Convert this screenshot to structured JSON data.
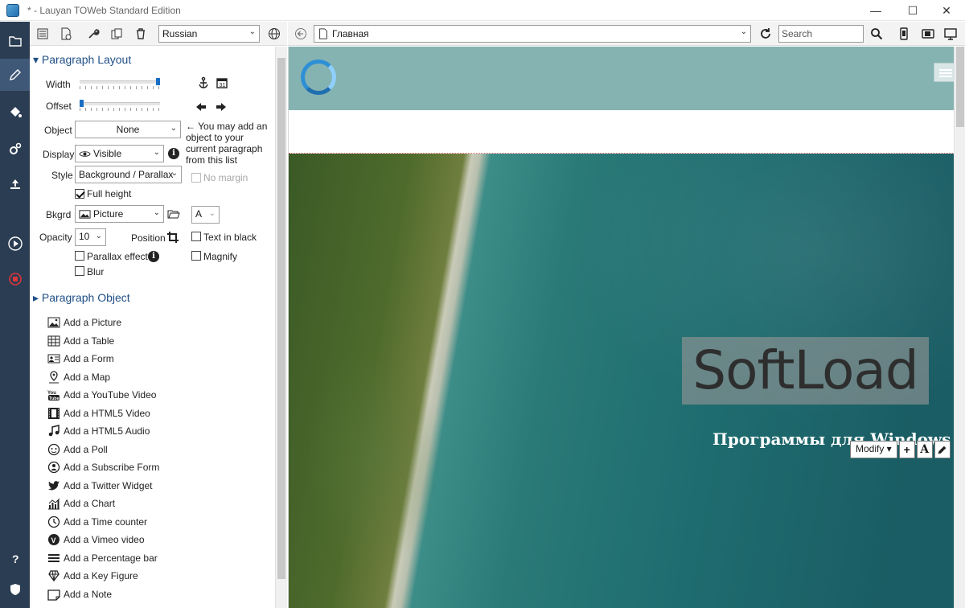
{
  "window": {
    "title": "* - Lauyan TOWeb Standard Edition",
    "minimize": "—",
    "maximize": "☐",
    "close": "✕"
  },
  "toolbar_left": {
    "language": "Russian"
  },
  "paragraph_layout": {
    "heading": "Paragraph Layout",
    "width_label": "Width",
    "width_value": 1.0,
    "offset_label": "Offset",
    "offset_value": 0.0,
    "object_label": "Object",
    "object_value": "None",
    "object_hint": "← You may add an object to your current paragraph from this list",
    "display_label": "Display",
    "display_value": "Visible",
    "style_label": "Style",
    "style_value": "Background / Parallax",
    "no_margin": "No margin",
    "full_height": "Full height",
    "bkgrd_label": "Bkgrd",
    "bkgrd_value": "Picture",
    "font_value": "A",
    "opacity_label": "Opacity",
    "opacity_value": "10",
    "position_label": "Position",
    "text_in_black": "Text in black",
    "parallax_effect": "Parallax effect",
    "magnify": "Magnify",
    "blur": "Blur"
  },
  "paragraph_object": {
    "heading": "Paragraph Object",
    "items": [
      {
        "label": "Add a Picture",
        "icon": "picture-icon"
      },
      {
        "label": "Add a Table",
        "icon": "table-icon"
      },
      {
        "label": "Add a Form",
        "icon": "form-icon"
      },
      {
        "label": "Add a Map",
        "icon": "map-icon"
      },
      {
        "label": "Add a YouTube Video",
        "icon": "youtube-icon"
      },
      {
        "label": "Add a HTML5 Video",
        "icon": "film-icon"
      },
      {
        "label": "Add a HTML5 Audio",
        "icon": "music-icon"
      },
      {
        "label": "Add a Poll",
        "icon": "poll-icon"
      },
      {
        "label": "Add a Subscribe Form",
        "icon": "subscribe-icon"
      },
      {
        "label": "Add a Twitter Widget",
        "icon": "twitter-icon"
      },
      {
        "label": "Add a Chart",
        "icon": "chart-icon"
      },
      {
        "label": "Add a Time counter",
        "icon": "clock-icon"
      },
      {
        "label": "Add a Vimeo video",
        "icon": "vimeo-icon"
      },
      {
        "label": "Add a Percentage bar",
        "icon": "percentage-bar-icon"
      },
      {
        "label": "Add a Key Figure",
        "icon": "key-figure-icon"
      },
      {
        "label": "Add a Note",
        "icon": "note-icon"
      }
    ]
  },
  "toolbar_right": {
    "page": "Главная",
    "search_placeholder": "Search"
  },
  "preview": {
    "hero_title": "SoftLoad",
    "hero_subtitle": "Программы для Windows",
    "modify_label": "Modify ▾",
    "add_symbol": "+",
    "text_symbol": "A"
  },
  "colors": {
    "rail": "#2b3d52",
    "header": "#84b3b2",
    "section_heading": "#1f4f86",
    "accent": "#1a6fc4"
  }
}
